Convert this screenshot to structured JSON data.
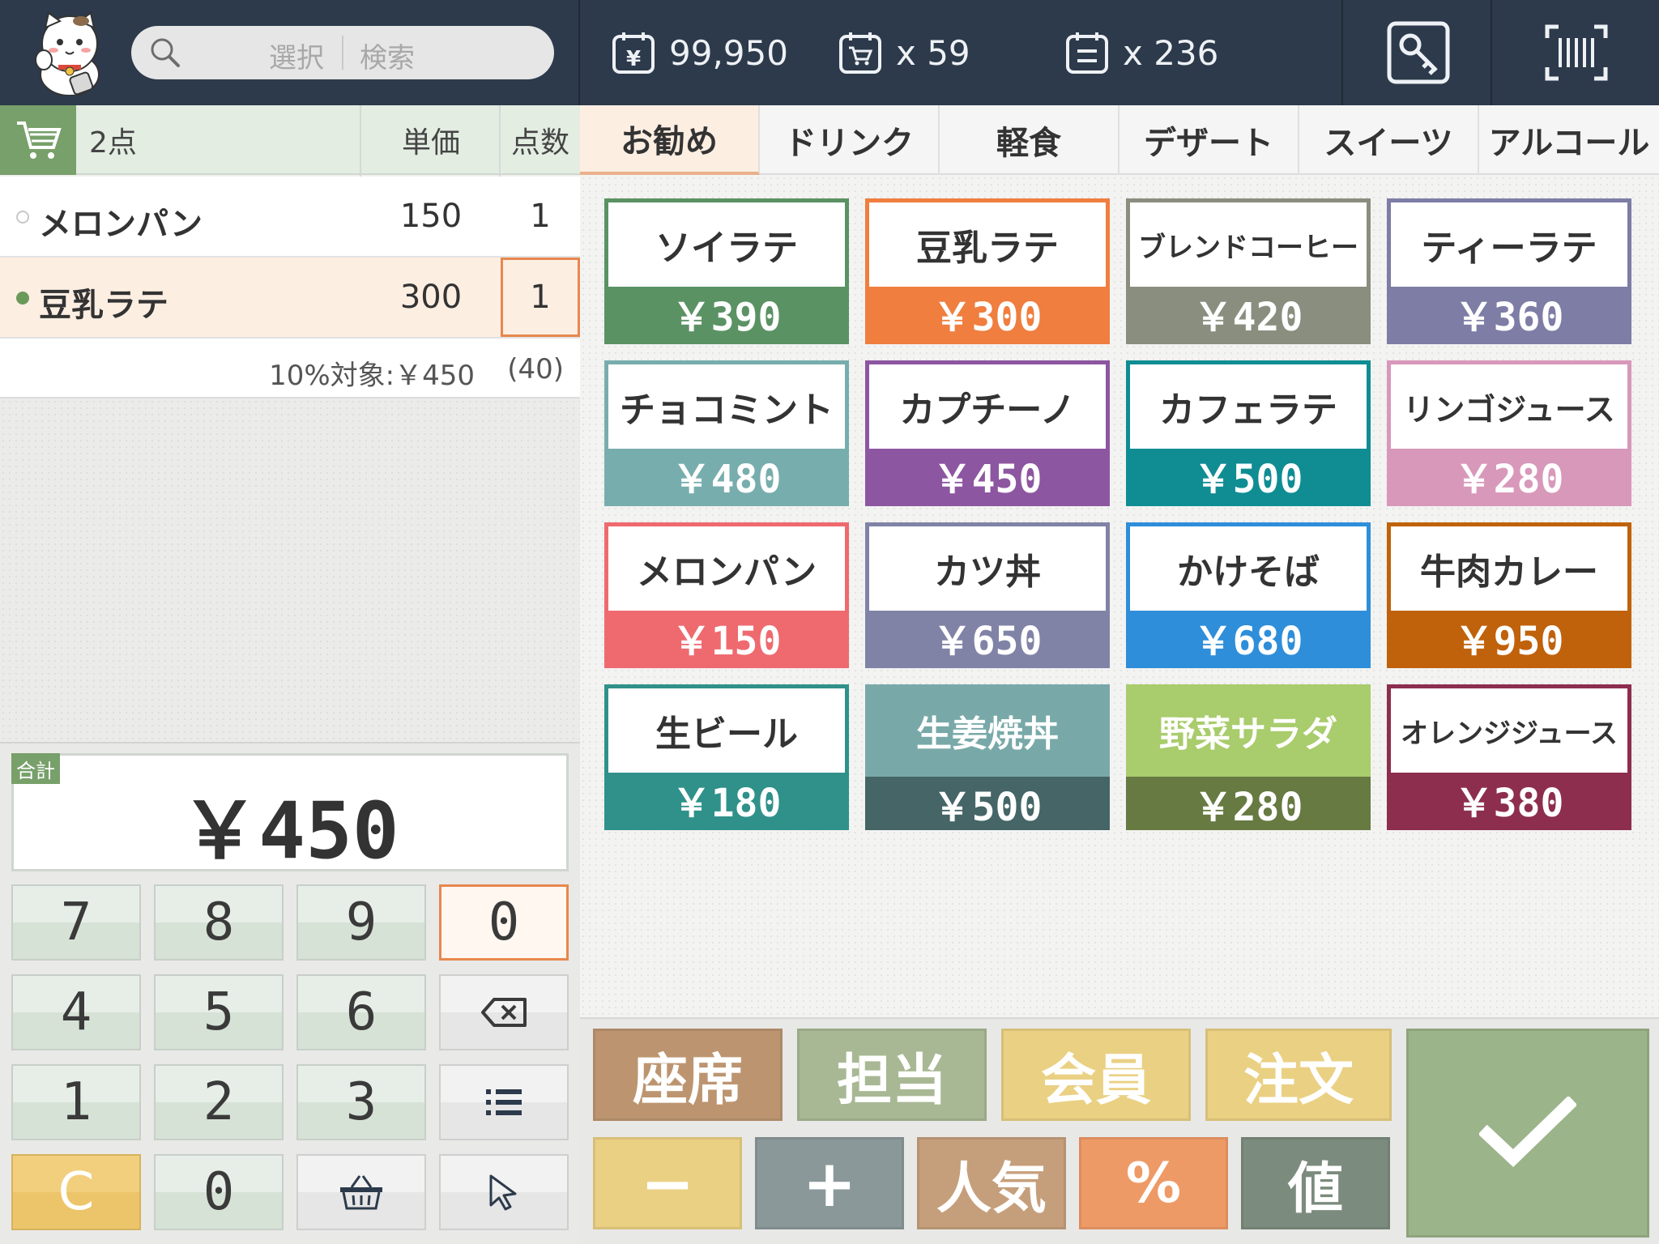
{
  "header": {
    "search": {
      "select_label": "選択",
      "search_label": "検索"
    },
    "stats": {
      "sales": "99,950",
      "carts": "x 59",
      "receipts": "x 236"
    }
  },
  "cart": {
    "count_label": "2点",
    "col_price": "単価",
    "col_qty": "点数",
    "items": [
      {
        "name": "メロンパン",
        "price": "150",
        "qty": "1",
        "dot": "#d0d0d0"
      },
      {
        "name": "豆乳ラテ",
        "price": "300",
        "qty": "1",
        "dot": "#6a9a5a"
      }
    ],
    "tax_label": "10%対象:￥450",
    "tax_amount": "(40)"
  },
  "total": {
    "label": "合計",
    "value": "￥450"
  },
  "keypad": {
    "keys": [
      "7",
      "8",
      "9",
      "0",
      "4",
      "5",
      "6",
      "1",
      "2",
      "3",
      "C",
      "0"
    ]
  },
  "tabs": [
    "お勧め",
    "ドリンク",
    "軽食",
    "デザート",
    "スイーツ",
    "アルコール"
  ],
  "products": [
    {
      "name": "ソイラテ",
      "price": "￥390",
      "color": "#5a9264"
    },
    {
      "name": "豆乳ラテ",
      "price": "￥300",
      "color": "#ef7e3f"
    },
    {
      "name": "ブレンドコーヒー",
      "price": "￥420",
      "color": "#8a8e7f"
    },
    {
      "name": "ティーラテ",
      "price": "￥360",
      "color": "#7d7da6"
    },
    {
      "name": "チョコミント",
      "price": "￥480",
      "color": "#78adad"
    },
    {
      "name": "カプチーノ",
      "price": "￥450",
      "color": "#8d56a1"
    },
    {
      "name": "カフェラテ",
      "price": "￥500",
      "color": "#0f8d93"
    },
    {
      "name": "リンゴジュース",
      "price": "￥280",
      "color": "#d898ba"
    },
    {
      "name": "メロンパン",
      "price": "￥150",
      "color": "#ee6a6f"
    },
    {
      "name": "カツ丼",
      "price": "￥650",
      "color": "#8083a6"
    },
    {
      "name": "かけそば",
      "price": "￥680",
      "color": "#2e8ed9"
    },
    {
      "name": "牛肉カレー",
      "price": "￥950",
      "color": "#c0620b"
    },
    {
      "name": "生ビール",
      "price": "￥180",
      "color": "#2f918a"
    },
    {
      "name": "生姜焼丼",
      "price": "￥500",
      "color": "#78a9a8"
    },
    {
      "name": "野菜サラダ",
      "price": "￥280",
      "color": "#a9cc6c"
    },
    {
      "name": "オレンジジュース",
      "price": "￥380",
      "color": "#8d2e4f"
    }
  ],
  "functions": {
    "seat": "座席",
    "staff": "担当",
    "member": "会員",
    "order": "注文",
    "minus": "−",
    "plus": "+",
    "popular": "人気",
    "percent": "%",
    "value": "値"
  }
}
